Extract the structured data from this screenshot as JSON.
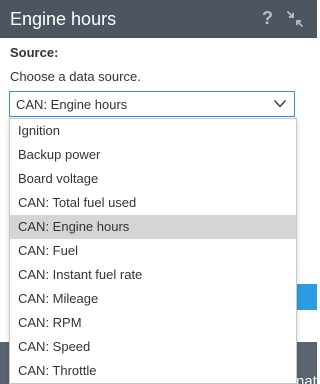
{
  "dialog": {
    "title": "Engine hours",
    "help_glyph": "?",
    "icons": [
      "help-icon",
      "collapse-icon"
    ]
  },
  "source": {
    "label": "Source:",
    "hint": "Choose a data source.",
    "selected_value": "CAN: Engine hours"
  },
  "dropdown": {
    "selected_index": 4,
    "items": [
      "Ignition",
      "Backup power",
      "Board voltage",
      "CAN: Total fuel used",
      "CAN: Engine hours",
      "CAN: Fuel",
      "CAN: Instant fuel rate",
      "CAN: Mileage",
      "CAN: RPM",
      "CAN: Speed",
      "CAN: Throttle"
    ]
  },
  "footer": {
    "partial_text": "nat"
  },
  "colors": {
    "header_bg": "#4c5560",
    "accent": "#2b9de0",
    "select_border": "#3e8ed0",
    "selected_item_bg": "#d5d5d5"
  }
}
